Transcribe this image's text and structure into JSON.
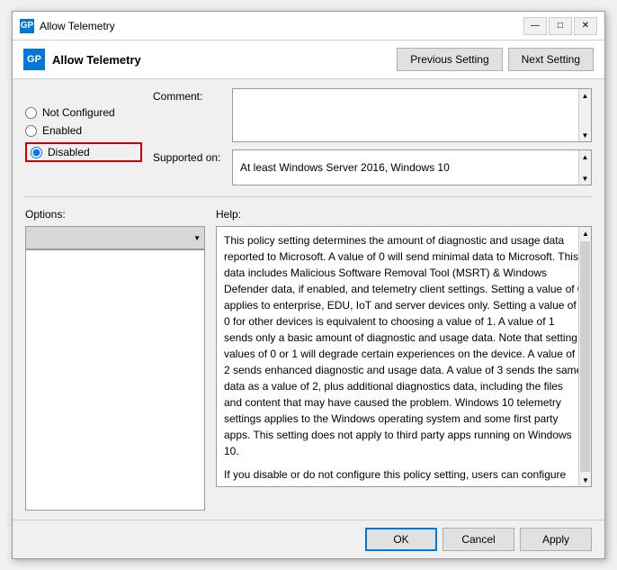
{
  "titlebar": {
    "title": "Allow Telemetry",
    "icon_label": "GP",
    "minimize": "—",
    "maximize": "□",
    "close": "✕"
  },
  "header": {
    "title": "Allow Telemetry",
    "prev_button": "Previous Setting",
    "next_button": "Next Setting"
  },
  "radio_options": {
    "not_configured": "Not Configured",
    "enabled": "Enabled",
    "disabled": "Disabled"
  },
  "selected_radio": "disabled",
  "comment_label": "Comment:",
  "supported_label": "Supported on:",
  "supported_value": "At least Windows Server 2016, Windows 10",
  "options_label": "Options:",
  "help_label": "Help:",
  "help_text_p1": "This policy setting determines the amount of diagnostic and usage data reported to Microsoft. A value of 0 will send minimal data to Microsoft. This data includes Malicious Software Removal Tool (MSRT) & Windows Defender data, if enabled, and telemetry client settings. Setting a value of 0 applies to enterprise, EDU, IoT and server devices only. Setting a value of 0 for other devices is equivalent to choosing a value of 1. A value of 1 sends only a basic amount of diagnostic and usage data. Note that setting values of 0 or 1 will degrade certain experiences on the device. A value of 2 sends enhanced diagnostic and usage data. A value of 3 sends the same data as a value of 2, plus additional diagnostics data, including the files and content that may have caused the problem. Windows 10 telemetry settings applies to the Windows operating system and some first party apps. This setting does not apply to third party apps running on Windows 10.",
  "help_text_p2": "If you disable or do not configure this policy setting, users can configure the Telemetry level in Settings.",
  "footer": {
    "ok": "OK",
    "cancel": "Cancel",
    "apply": "Apply"
  }
}
